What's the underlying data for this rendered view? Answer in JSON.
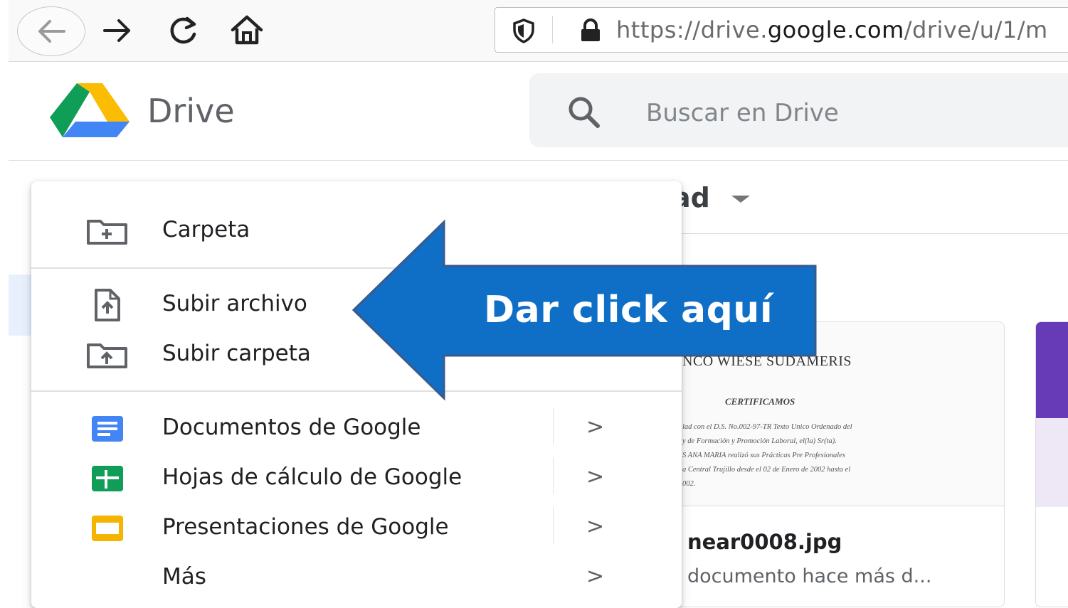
{
  "browser": {
    "url_prefix": "https://drive.",
    "url_domain": "google.com",
    "url_path": "/drive/u/1/m"
  },
  "drive": {
    "title": "Drive",
    "search_placeholder": "Buscar en Drive"
  },
  "background": {
    "section_title": "ad",
    "file_name": "near0008.jpg",
    "file_meta": "documento hace más d...",
    "doc_preview": {
      "bank": "NCO WIESE SUDAMERIS",
      "heading": "CERTIFICAMOS",
      "lines": [
        "lad con el D.S. No.002-97-TR Texto Unico Ordenado del",
        "y de Formación y Promoción Laboral, el(la) Sr(ta).",
        "S ANA MARIA realizó sus Prácticas Pre Profesionales",
        "a Central Trujillo desde el 02 de Enero de 2002 hasta el",
        "002."
      ]
    }
  },
  "menu": {
    "folder": "Carpeta",
    "upload_file": "Subir archivo",
    "upload_folder": "Subir carpeta",
    "docs": "Documentos de Google",
    "sheets": "Hojas de cálculo de Google",
    "slides": "Presentaciones de Google",
    "more": "Más",
    "chevron": ">"
  },
  "annotation": {
    "text": "Dar click aquí",
    "color": "#0f6fc6"
  },
  "colors": {
    "docs_blue": "#4285f4",
    "sheets_green": "#0f9d58",
    "slides_yellow": "#f4b400",
    "forms_purple": "#673ab7"
  }
}
